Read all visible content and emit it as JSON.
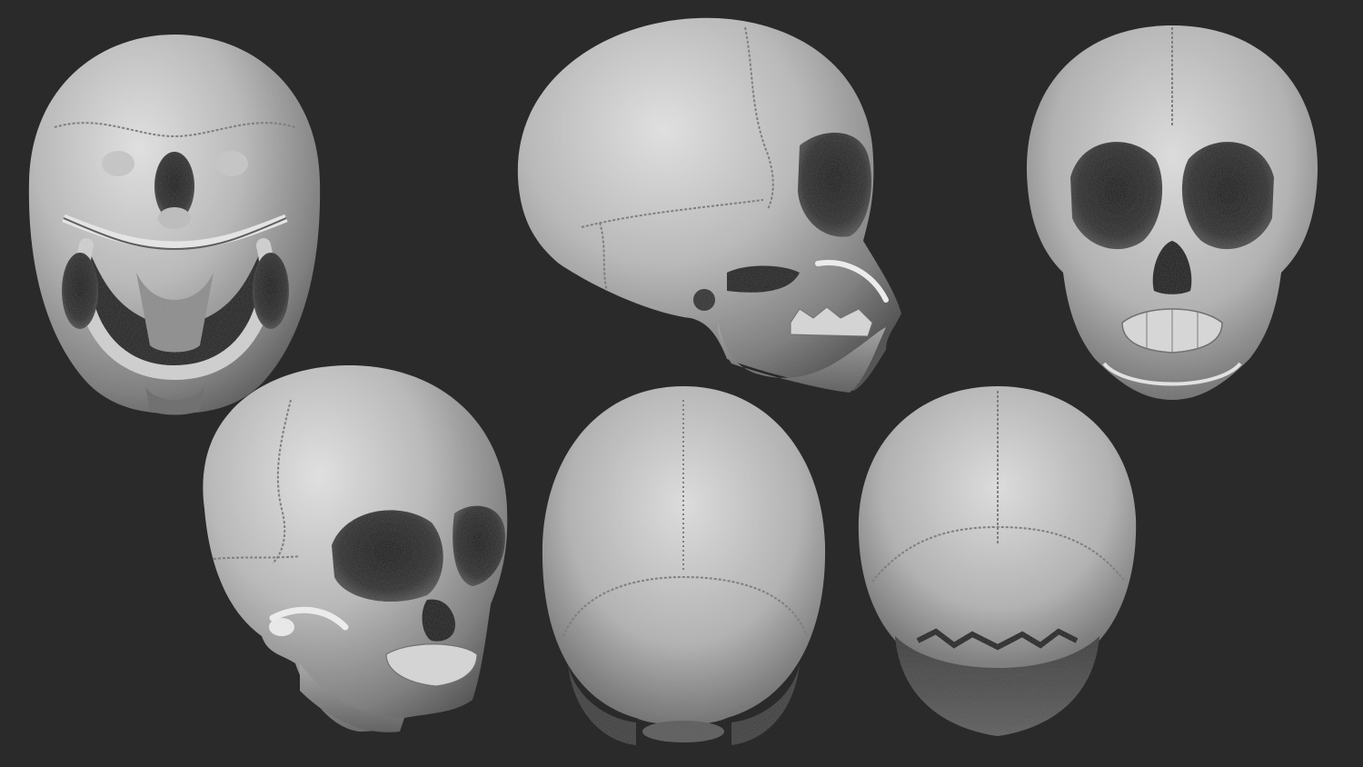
{
  "scene": {
    "background_color": "#2a2a2b",
    "bone_light": "#d9d9d9",
    "bone_mid": "#9a9a9a",
    "bone_dark": "#3a3a3a",
    "cavity_color": "#1a1a1a"
  },
  "views": [
    {
      "id": "inferior",
      "icon": "skull-inferior-view-icon"
    },
    {
      "id": "lateral",
      "icon": "skull-lateral-view-icon"
    },
    {
      "id": "anterior",
      "icon": "skull-anterior-view-icon"
    },
    {
      "id": "three-quarter",
      "icon": "skull-three-quarter-view-icon"
    },
    {
      "id": "superior",
      "icon": "skull-superior-view-icon"
    },
    {
      "id": "posterior",
      "icon": "skull-posterior-view-icon"
    }
  ]
}
